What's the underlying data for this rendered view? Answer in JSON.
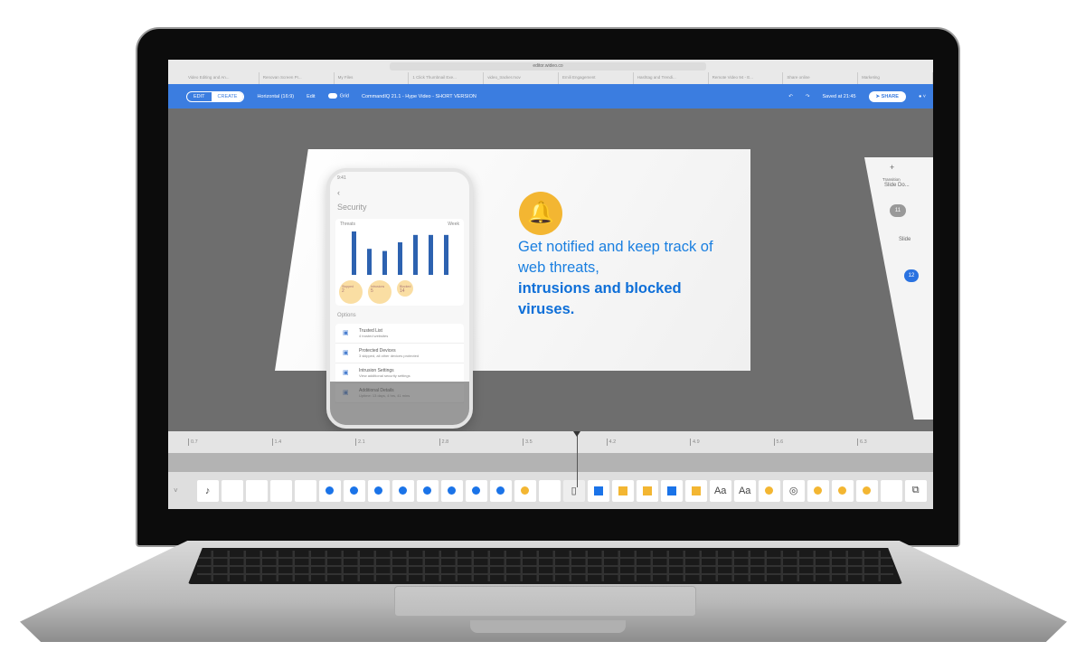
{
  "browser": {
    "url": "editor.wideo.co",
    "tabs": [
      "Video Editing and An...",
      "Renovan Screen Pr...",
      "My Files",
      "1 Click Thumbnail Exe...",
      "video_tracker.mov",
      "Emili Engagement",
      "Hashtag and Trendi...",
      "Remote Video 94 - E...",
      "Share online",
      "Marketing"
    ]
  },
  "toolbar": {
    "edit": "EDIT",
    "create": "CREATE",
    "format": "Horizontal (16:9)",
    "edit_menu": "Edit",
    "grid": "Grid",
    "project_title": "CommandIQ 21.1 - Hype Video - SHORT VERSION",
    "saved": "Saved at 21:45",
    "share": "SHARE"
  },
  "slide": {
    "headline": "Get notified and keep track of web threats,",
    "headline_bold": "intrusions and blocked viruses.",
    "accent": "#1a7fe0",
    "bell_color": "#f3b632"
  },
  "phone": {
    "time": "9:41",
    "title": "Security",
    "chart_label": "Threats",
    "period": "Week",
    "bars": [
      100,
      60,
      55,
      75,
      92,
      92,
      92
    ],
    "stats": [
      {
        "label": "Stopped",
        "value": "2"
      },
      {
        "label": "Intrusions",
        "value": "5"
      },
      {
        "label": "Blocked",
        "value": "14"
      }
    ],
    "options_title": "Options",
    "options": [
      {
        "title": "Trusted List",
        "sub": "4 trusted websites"
      },
      {
        "title": "Protected Devices",
        "sub": "3 skipped, all other devices protected"
      },
      {
        "title": "Intrusion Settings",
        "sub": "View additional security settings"
      },
      {
        "title": "Additional Details",
        "sub": "Uptime: 13 days, 4 hrs, 41 mins"
      }
    ]
  },
  "right_panel": {
    "transition_label": "Transition",
    "transition_1": "Slide Do...",
    "scene_1": "11",
    "transition_2": "Slide",
    "scene_2": "12"
  },
  "timeline": {
    "ticks": [
      "0.7",
      "1.4",
      "2.1",
      "2.8",
      "3.5",
      "4.2",
      "4.9",
      "5.6",
      "6.3"
    ],
    "playhead": "3.9"
  },
  "tray": [
    {
      "t": "icon",
      "v": "♪"
    },
    {
      "t": "blank"
    },
    {
      "t": "blank"
    },
    {
      "t": "blank"
    },
    {
      "t": "blank"
    },
    {
      "t": "dot",
      "c": "#1a73e8"
    },
    {
      "t": "dot",
      "c": "#1a73e8"
    },
    {
      "t": "dot",
      "c": "#1a73e8"
    },
    {
      "t": "dot",
      "c": "#1a73e8"
    },
    {
      "t": "dot",
      "c": "#1a73e8"
    },
    {
      "t": "dot",
      "c": "#1a73e8"
    },
    {
      "t": "dot",
      "c": "#1a73e8"
    },
    {
      "t": "dot",
      "c": "#1a73e8"
    },
    {
      "t": "dot",
      "c": "#f3b632"
    },
    {
      "t": "blank"
    },
    {
      "t": "icon",
      "v": "▯"
    },
    {
      "t": "sq",
      "c": "#1a73e8"
    },
    {
      "t": "sq",
      "c": "#f3b632"
    },
    {
      "t": "sq",
      "c": "#f3b632"
    },
    {
      "t": "sq",
      "c": "#1a73e8"
    },
    {
      "t": "sq",
      "c": "#f3b632"
    },
    {
      "t": "text",
      "v": "Aa"
    },
    {
      "t": "text",
      "v": "Aa"
    },
    {
      "t": "dot",
      "c": "#f3b632"
    },
    {
      "t": "icon",
      "v": "◎"
    },
    {
      "t": "dot",
      "c": "#f3b632"
    },
    {
      "t": "dot",
      "c": "#f3b632"
    },
    {
      "t": "dot",
      "c": "#f3b632"
    },
    {
      "t": "blank"
    },
    {
      "t": "icon",
      "v": "⧉"
    }
  ]
}
